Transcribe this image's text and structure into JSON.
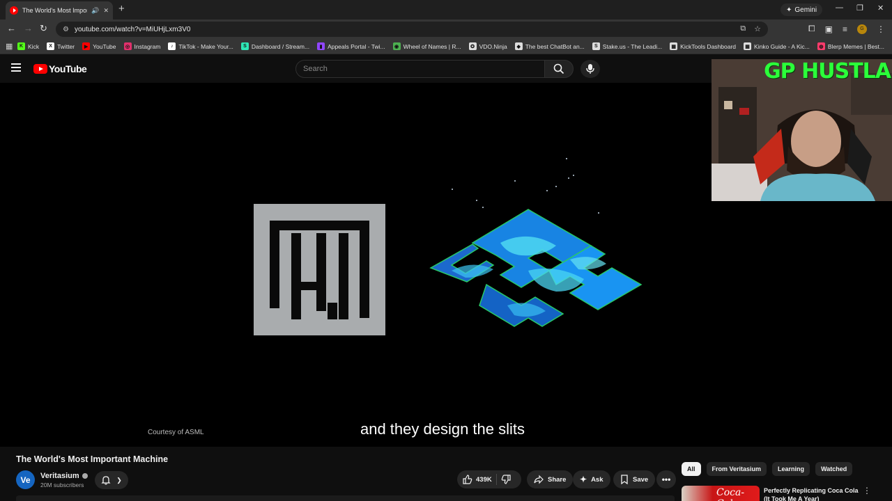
{
  "browser": {
    "tab_title": "The World's Most Important Machine",
    "new_tab_icon": "plus-icon",
    "gemini_label": "Gemini",
    "url": "youtube.com/watch?v=MiUHjLxm3V0",
    "bookmarks": [
      {
        "label": "Kick",
        "color": "#53fc18",
        "glyph": "K"
      },
      {
        "label": "Twitter",
        "color": "#ffffff",
        "glyph": "X"
      },
      {
        "label": "YouTube",
        "color": "#ff0000",
        "glyph": "▶"
      },
      {
        "label": "Instagram",
        "color": "#e1306c",
        "glyph": "◎"
      },
      {
        "label": "TikTok - Make Your...",
        "color": "#ffffff",
        "glyph": "♪"
      },
      {
        "label": "Dashboard / Stream...",
        "color": "#2ee6b5",
        "glyph": "S"
      },
      {
        "label": "Appeals Portal - Twi...",
        "color": "#9146ff",
        "glyph": "▮"
      },
      {
        "label": "Wheel of Names | R...",
        "color": "#4caf50",
        "glyph": "◉"
      },
      {
        "label": "VDO.Ninja",
        "color": "#dddddd",
        "glyph": "✪"
      },
      {
        "label": "The best ChatBot an...",
        "color": "#dddddd",
        "glyph": "◆"
      },
      {
        "label": "Stake.us - The Leadi...",
        "color": "#dddddd",
        "glyph": "S"
      },
      {
        "label": "KickTools Dashboard",
        "color": "#dddddd",
        "glyph": "▦"
      },
      {
        "label": "Kinko Guide - A Kic...",
        "color": "#dddddd",
        "glyph": "▦"
      },
      {
        "label": "Blerp Memes | Best...",
        "color": "#ff3b6b",
        "glyph": "◍"
      }
    ]
  },
  "youtube": {
    "logo_text": "YouTube",
    "search_placeholder": "Search",
    "video": {
      "caption": "and they design the slits",
      "courtesy": "Courtesy of ASML",
      "overlay_title": "GP HUSTLA"
    },
    "title": "The World's Most Important Machine",
    "channel": {
      "name": "Veritasium",
      "avatar_text": "Ve",
      "subscribers": "20M subscribers"
    },
    "actions": {
      "likes": "439K",
      "share": "Share",
      "ask": "Ask",
      "save": "Save"
    },
    "chips": [
      "All",
      "From Veritasium",
      "Learning",
      "Watched"
    ],
    "recommended": {
      "title": "Perfectly Replicating Coca Cola (It Took Me A Year)",
      "thumb_text": "Coca-Cola"
    }
  }
}
